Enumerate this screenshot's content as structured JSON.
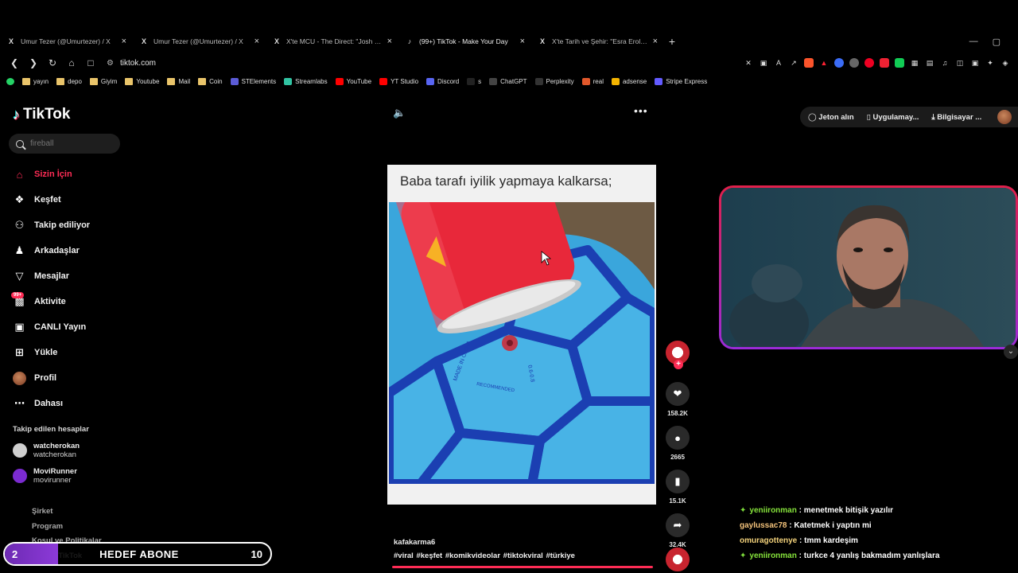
{
  "browser": {
    "tabs": [
      {
        "icon": "X",
        "title": "Umur Tezer (@Umurtezer) / X",
        "active": false
      },
      {
        "icon": "X",
        "title": "Umur Tezer (@Umurtezer) / X",
        "active": false
      },
      {
        "icon": "X",
        "title": "X'te MCU - The Direct: \"Josh Brolin s",
        "active": false
      },
      {
        "icon": "♪",
        "title": "(99+) TikTok - Make Your Day",
        "active": true
      },
      {
        "icon": "X",
        "title": "X'te Tarih ve Şehir: \"Esra Erol'un para",
        "active": false
      }
    ],
    "url": "tiktok.com",
    "bookmarks": [
      {
        "label": "yayın",
        "type": "folder"
      },
      {
        "label": "depo",
        "type": "folder"
      },
      {
        "label": "Giyim",
        "type": "folder"
      },
      {
        "label": "Youtube",
        "type": "folder"
      },
      {
        "label": "Mail",
        "type": "folder"
      },
      {
        "label": "Coin",
        "type": "folder"
      },
      {
        "label": "STElements",
        "type": "site",
        "color": "#5b5bd6"
      },
      {
        "label": "Streamlabs",
        "type": "site",
        "color": "#31c3a2"
      },
      {
        "label": "YouTube",
        "type": "site",
        "color": "#ff0000"
      },
      {
        "label": "YT Studio",
        "type": "site",
        "color": "#ff0000"
      },
      {
        "label": "Discord",
        "type": "site",
        "color": "#5865f2"
      },
      {
        "label": "s",
        "type": "site",
        "color": "#222"
      },
      {
        "label": "ChatGPT",
        "type": "site",
        "color": "#444"
      },
      {
        "label": "Perplexity",
        "type": "site",
        "color": "#333"
      },
      {
        "label": "real",
        "type": "site",
        "color": "#e2582b"
      },
      {
        "label": "adsense",
        "type": "site",
        "color": "#f4b400"
      },
      {
        "label": "Stripe Express",
        "type": "site",
        "color": "#635bff"
      }
    ]
  },
  "sidebar": {
    "logo": "TikTok",
    "search_placeholder": "fireball",
    "items": [
      {
        "label": "Sizin İçin",
        "icon": "home-icon",
        "active": true
      },
      {
        "label": "Keşfet",
        "icon": "compass-icon",
        "active": false
      },
      {
        "label": "Takip ediliyor",
        "icon": "user-follow-icon",
        "active": false
      },
      {
        "label": "Arkadaşlar",
        "icon": "friends-icon",
        "active": false
      },
      {
        "label": "Mesajlar",
        "icon": "send-icon",
        "active": false
      },
      {
        "label": "Aktivite",
        "icon": "inbox-icon",
        "active": false,
        "badge": "99+"
      },
      {
        "label": "CANLI Yayın",
        "icon": "live-icon",
        "active": false
      },
      {
        "label": "Yükle",
        "icon": "upload-icon",
        "active": false
      },
      {
        "label": "Profil",
        "icon": "avatar",
        "active": false
      },
      {
        "label": "Dahası",
        "icon": "more-icon",
        "active": false
      }
    ],
    "following_header": "Takip edilen hesaplar",
    "accounts": [
      {
        "name": "watcherokan",
        "username": "watcherokan",
        "color": "#cfcfcf"
      },
      {
        "name": "MoviRunner",
        "username": "movirunner",
        "color": "#7b2bd0"
      }
    ],
    "footer": [
      "Şirket",
      "Program",
      "Koşul ve Politikalar",
      "© 2025 TikTok"
    ]
  },
  "header": {
    "coins": "Jeton alın",
    "app": "Uygulamay...",
    "desktop": "Bilgisayar ..."
  },
  "video": {
    "caption": "Baba tarafı iyilik yapmaya kalkarsa;",
    "ball_text": "MADE IN CHINA · RECOMMENDED · 0.6-0.8",
    "author": "kafakarma6",
    "tags": "#viral #keşfet #komikvideolar #tiktokviral #türkiye",
    "progress_pct": 100,
    "likes": "158.2K",
    "comments": "2665",
    "saves": "15.1K",
    "shares": "32.4K"
  },
  "chat": [
    {
      "user": "yeniironman",
      "message": "menetmek bitişik yazılır",
      "color": "green",
      "diamond": true
    },
    {
      "user": "gaylussac78",
      "message": "Katetmek i yaptın mi",
      "color": "orange",
      "diamond": false
    },
    {
      "user": "omuragottenye",
      "message": "tmm kardeşim",
      "color": "yellow",
      "diamond": false
    },
    {
      "user": "yeniironman",
      "message": "turkce 4 yanlış bakmadım yanlışlara",
      "color": "green",
      "diamond": true
    }
  ],
  "goal": {
    "current": "2",
    "title": "HEDEF ABONE",
    "target": "10",
    "fraction": 0.2
  }
}
